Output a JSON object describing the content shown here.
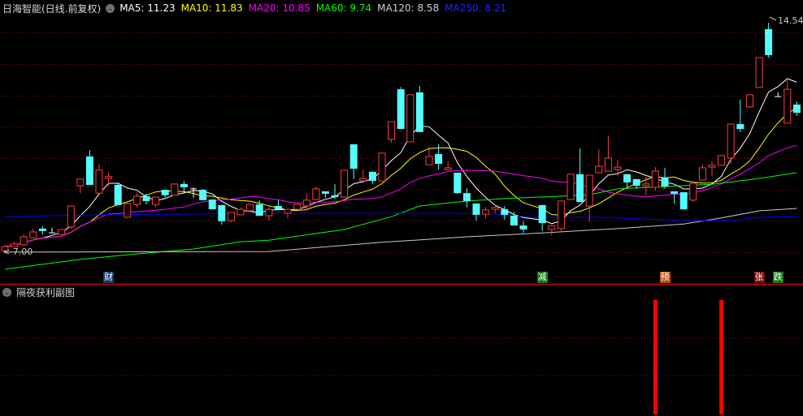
{
  "header": {
    "title": "日海智能(日线.前复权)",
    "ma": [
      {
        "label": "MA5: 11.23",
        "color": "#ffffff"
      },
      {
        "label": "MA10: 11.83",
        "color": "#ffff00"
      },
      {
        "label": "MA20: 10.85",
        "color": "#ff00ff"
      },
      {
        "label": "MA60: 9.74",
        "color": "#00ff00"
      },
      {
        "label": "MA120: 8.58",
        "color": "#d0d0d0"
      },
      {
        "label": "MA250: 8.21",
        "color": "#2020ff"
      }
    ]
  },
  "price_labels": {
    "low": "7.00",
    "high": "14.54"
  },
  "subpane": {
    "title": "隔夜获利副图"
  },
  "markers": [
    {
      "text": "财",
      "index": 11,
      "bg": "#14406c"
    },
    {
      "text": "减",
      "index": 57,
      "bg": "#137a13"
    },
    {
      "text": "预",
      "index": 70,
      "bg": "#c05010"
    },
    {
      "text": "张",
      "index": 80,
      "bg": "#7a0a0a"
    },
    {
      "text": "跌",
      "index": 82,
      "bg": "#137a13"
    }
  ],
  "colors": {
    "up": "#ff3c3c",
    "down": "#54fcfc",
    "doji": "#ffffff",
    "grid": "#7a1010",
    "separator": "#d00000",
    "signal": "#ff0000"
  },
  "chart_data": {
    "type": "candlestick",
    "price_range": [
      7.0,
      14.54
    ],
    "candles_ohlc": [
      [
        7.08,
        7.27,
        7.05,
        7.21
      ],
      [
        7.21,
        7.37,
        7.2,
        7.29
      ],
      [
        7.27,
        7.61,
        7.24,
        7.53
      ],
      [
        7.5,
        7.8,
        7.5,
        7.69
      ],
      [
        7.8,
        7.88,
        7.61,
        7.72
      ],
      [
        7.66,
        7.82,
        7.66,
        7.66
      ],
      [
        7.61,
        7.77,
        7.61,
        7.77
      ],
      [
        7.85,
        8.54,
        7.8,
        8.54
      ],
      [
        9.2,
        9.42,
        8.96,
        9.42
      ],
      [
        10.16,
        10.37,
        9.23,
        9.23
      ],
      [
        8.96,
        9.92,
        8.96,
        9.71
      ],
      [
        9.44,
        9.63,
        9.18,
        9.5
      ],
      [
        9.23,
        9.28,
        8.57,
        8.57
      ],
      [
        8.17,
        8.7,
        8.14,
        8.62
      ],
      [
        8.59,
        8.96,
        8.49,
        8.86
      ],
      [
        8.86,
        8.94,
        8.59,
        8.7
      ],
      [
        8.59,
        8.83,
        8.51,
        8.83
      ],
      [
        9.07,
        9.07,
        8.81,
        8.89
      ],
      [
        8.89,
        9.26,
        8.89,
        9.26
      ],
      [
        9.26,
        9.36,
        8.96,
        9.15
      ],
      [
        9.1,
        9.15,
        8.81,
        9.1
      ],
      [
        9.07,
        9.1,
        8.73,
        8.73
      ],
      [
        8.75,
        8.75,
        8.43,
        8.43
      ],
      [
        8.57,
        8.57,
        7.93,
        8.04
      ],
      [
        8.06,
        8.33,
        8.01,
        8.33
      ],
      [
        8.25,
        8.49,
        8.25,
        8.43
      ],
      [
        8.38,
        8.59,
        8.38,
        8.59
      ],
      [
        8.59,
        8.73,
        8.22,
        8.22
      ],
      [
        8.22,
        8.51,
        8.06,
        8.43
      ],
      [
        8.54,
        8.73,
        8.43,
        8.43
      ],
      [
        8.3,
        8.43,
        8.12,
        8.43
      ],
      [
        8.43,
        8.59,
        8.43,
        8.59
      ],
      [
        8.54,
        8.94,
        8.38,
        8.73
      ],
      [
        8.75,
        9.18,
        8.75,
        9.1
      ],
      [
        9.02,
        9.02,
        8.81,
        8.94
      ],
      [
        8.89,
        9.26,
        8.78,
        8.83
      ],
      [
        8.83,
        9.71,
        8.83,
        9.71
      ],
      [
        10.56,
        10.56,
        9.42,
        9.76
      ],
      [
        9.36,
        9.73,
        9.36,
        9.44
      ],
      [
        9.66,
        9.66,
        9.26,
        9.36
      ],
      [
        9.36,
        10.27,
        9.36,
        10.27
      ],
      [
        10.72,
        11.3,
        10.61,
        11.3
      ],
      [
        12.36,
        12.44,
        11.06,
        11.06
      ],
      [
        10.64,
        12.18,
        10.64,
        12.18
      ],
      [
        12.26,
        12.47,
        10.96,
        10.96
      ],
      [
        9.89,
        10.48,
        9.89,
        10.16
      ],
      [
        10.24,
        10.56,
        9.73,
        9.92
      ],
      [
        9.73,
        10.0,
        9.73,
        9.79
      ],
      [
        9.63,
        9.63,
        8.94,
        8.96
      ],
      [
        8.96,
        9.12,
        8.49,
        8.7
      ],
      [
        8.62,
        8.62,
        8.06,
        8.25
      ],
      [
        8.27,
        8.51,
        8.12,
        8.41
      ],
      [
        8.43,
        8.59,
        8.3,
        8.49
      ],
      [
        8.43,
        8.54,
        8.09,
        8.25
      ],
      [
        8.22,
        8.35,
        7.9,
        7.9
      ],
      [
        7.9,
        8.04,
        7.66,
        7.77
      ],
      null,
      [
        8.57,
        8.57,
        7.72,
        7.98
      ],
      [
        7.77,
        7.9,
        7.58,
        7.9
      ],
      [
        7.8,
        8.7,
        7.72,
        8.7
      ],
      [
        8.75,
        9.58,
        8.73,
        9.58
      ],
      [
        9.58,
        10.42,
        8.67,
        8.67
      ],
      [
        8.54,
        9.55,
        8.04,
        9.55
      ],
      [
        9.63,
        10.4,
        9.63,
        9.84
      ],
      [
        9.68,
        10.82,
        9.68,
        10.11
      ],
      [
        9.73,
        10.05,
        9.52,
        9.81
      ],
      [
        9.58,
        9.58,
        9.15,
        9.31
      ],
      [
        9.42,
        9.42,
        9.1,
        9.2
      ],
      [
        9.2,
        9.5,
        8.89,
        9.26
      ],
      [
        9.15,
        9.81,
        9.04,
        9.68
      ],
      [
        9.47,
        9.79,
        9.1,
        9.18
      ],
      [
        9.02,
        9.02,
        8.62,
        8.94
      ],
      [
        8.99,
        8.99,
        8.41,
        8.43
      ],
      [
        8.73,
        9.28,
        8.67,
        9.28
      ],
      [
        9.39,
        9.89,
        9.39,
        9.79
      ],
      [
        9.81,
        10.0,
        9.52,
        9.87
      ],
      [
        9.87,
        10.19,
        9.87,
        10.19
      ],
      [
        10.11,
        11.22,
        9.92,
        11.22
      ],
      [
        11.22,
        12.02,
        10.96,
        11.06
      ],
      [
        11.78,
        12.18,
        11.78,
        12.18
      ],
      [
        12.42,
        13.4,
        12.42,
        13.4
      ],
      [
        14.33,
        14.54,
        13.4,
        13.48
      ],
      [
        12.12,
        12.26,
        12.12,
        12.12
      ],
      [
        11.25,
        12.71,
        11.25,
        12.36
      ],
      [
        11.86,
        11.96,
        11.49,
        11.59
      ]
    ],
    "computed_ma": [
      {
        "name": "MA5",
        "period": 5,
        "color": "#ffffff"
      },
      {
        "name": "MA10",
        "period": 10,
        "color": "#ffff00"
      },
      {
        "name": "MA20",
        "period": 20,
        "color": "#ff00ff"
      }
    ],
    "sampled_ma": [
      {
        "name": "MA60",
        "color": "#00ff00",
        "points": [
          [
            0,
            6.47
          ],
          [
            8,
            6.79
          ],
          [
            14,
            6.97
          ],
          [
            20,
            7.13
          ],
          [
            25,
            7.37
          ],
          [
            28,
            7.42
          ],
          [
            36,
            7.77
          ],
          [
            41,
            8.19
          ],
          [
            44,
            8.54
          ],
          [
            49,
            8.7
          ],
          [
            53,
            8.78
          ],
          [
            59,
            8.86
          ],
          [
            62,
            8.91
          ],
          [
            65,
            9.1
          ],
          [
            75,
            9.25
          ],
          [
            80,
            9.44
          ],
          [
            84,
            9.63
          ]
        ]
      },
      {
        "name": "MA120",
        "color": "#c8c8c8",
        "points": [
          [
            0,
            7.03
          ],
          [
            28,
            7.05
          ],
          [
            40,
            7.35
          ],
          [
            49,
            7.53
          ],
          [
            56,
            7.64
          ],
          [
            65,
            7.8
          ],
          [
            72,
            7.95
          ],
          [
            76,
            8.15
          ],
          [
            80,
            8.38
          ],
          [
            84,
            8.46
          ]
        ]
      },
      {
        "name": "MA250",
        "color": "#0000ff",
        "points": [
          [
            0,
            8.19
          ],
          [
            10,
            8.25
          ],
          [
            28,
            8.3
          ],
          [
            48,
            8.3
          ],
          [
            52,
            8.27
          ],
          [
            56,
            8.17
          ],
          [
            63,
            8.17
          ],
          [
            72,
            8.06
          ],
          [
            77,
            8.06
          ],
          [
            80,
            8.17
          ],
          [
            84,
            8.19
          ]
        ]
      }
    ],
    "subpane_signals": [
      {
        "index": 69,
        "value": 1
      },
      {
        "index": 76,
        "value": 1
      }
    ]
  }
}
